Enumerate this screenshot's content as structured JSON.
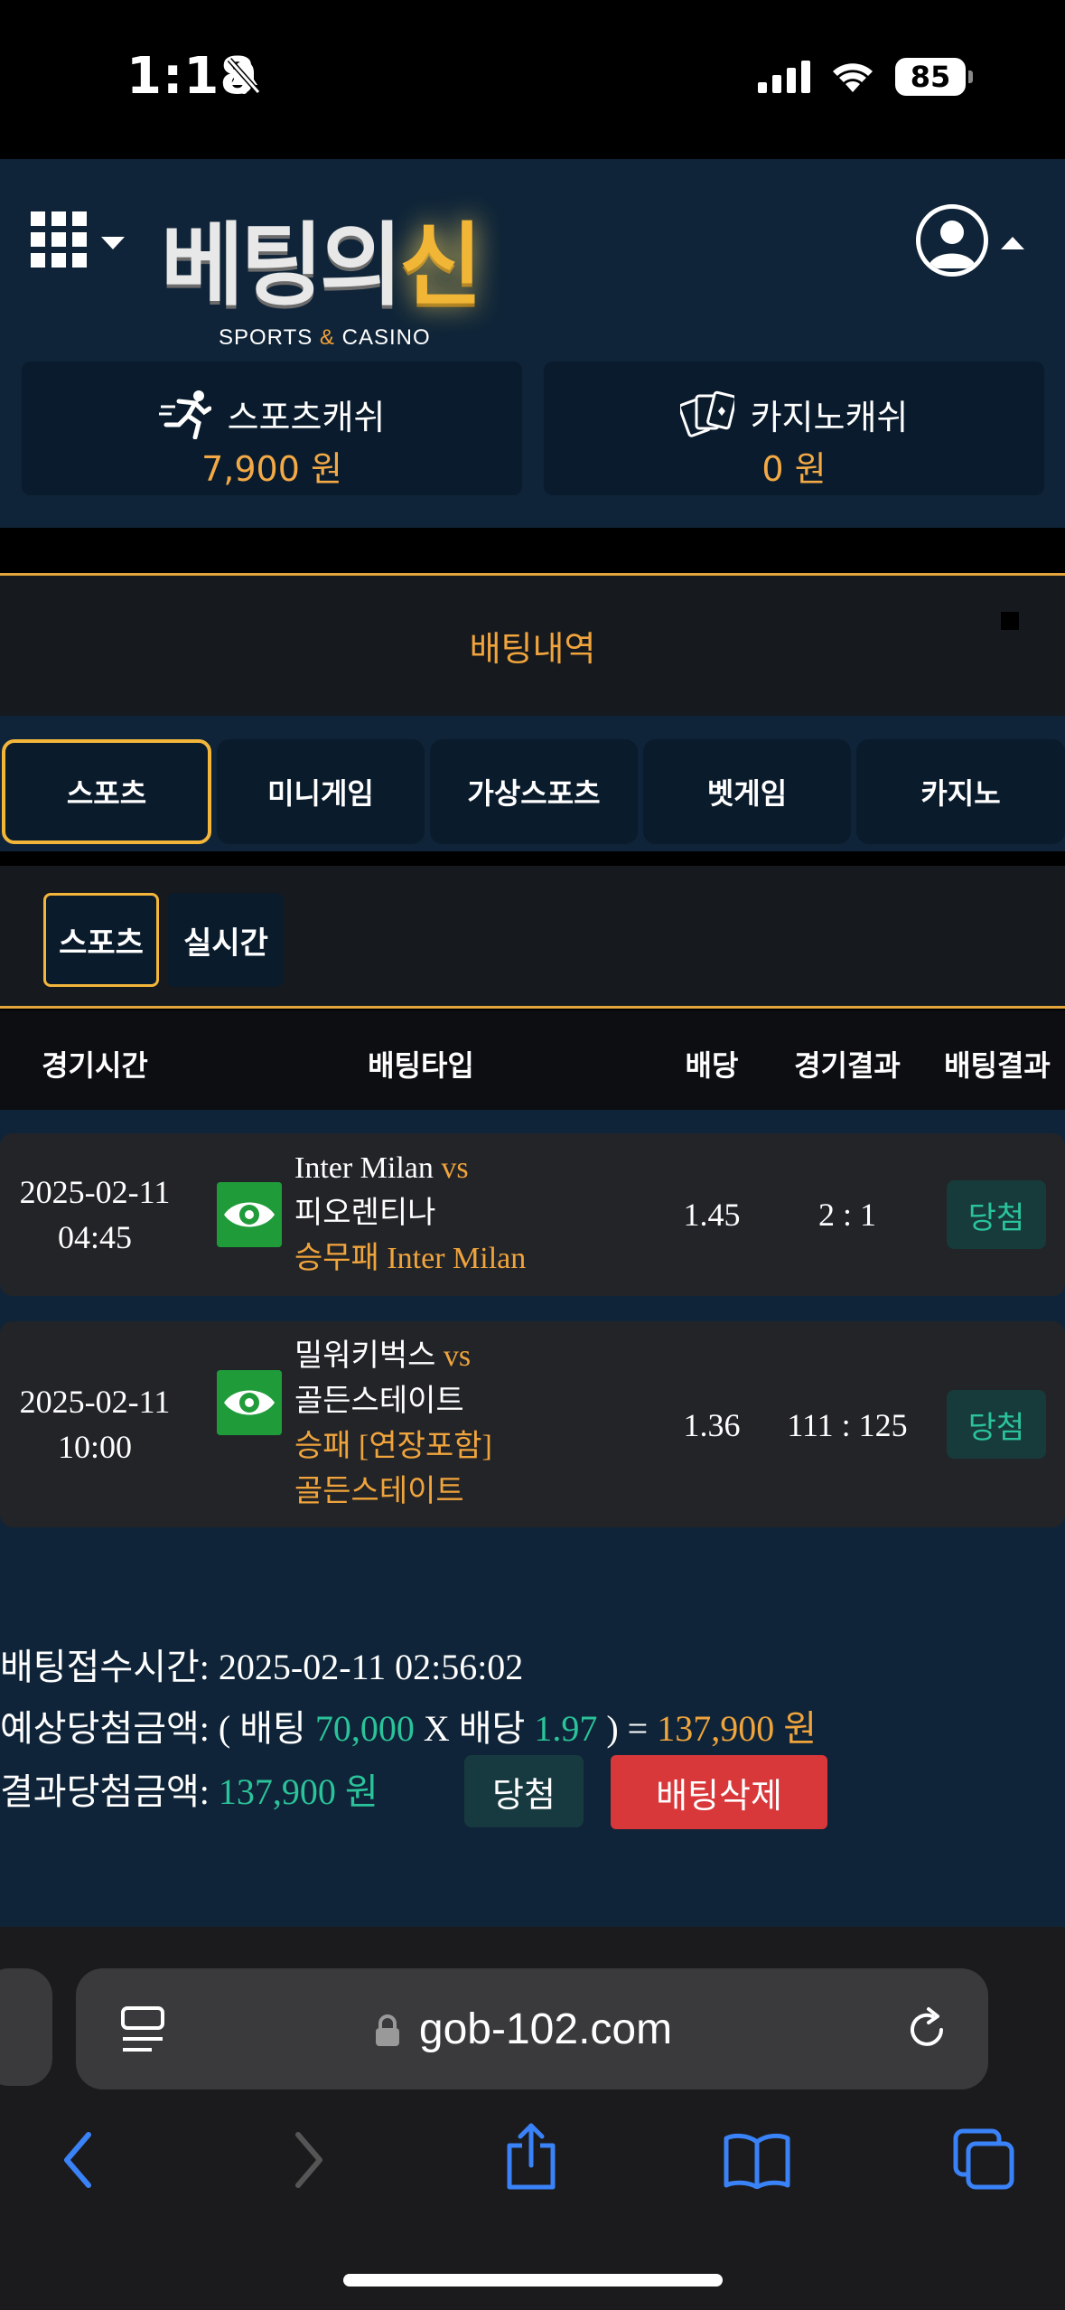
{
  "status_bar": {
    "time": "1:18",
    "battery": "85"
  },
  "header": {
    "logo_main": "베팅의",
    "logo_gold": "신",
    "logo_sub_left": "SPORTS",
    "logo_sub_amp": "&",
    "logo_sub_right": "CASINO",
    "sports_cash_label": "스포츠캐쉬",
    "sports_cash_value": "7,900 원",
    "casino_cash_label": "카지노캐쉬",
    "casino_cash_value": "0 원"
  },
  "page_title": "배팅내역",
  "tabs": [
    {
      "label": "스포츠",
      "active": true
    },
    {
      "label": "미니게임"
    },
    {
      "label": "가상스포츠"
    },
    {
      "label": "벳게임"
    },
    {
      "label": "카지노"
    }
  ],
  "subtabs": [
    {
      "label": "스포츠",
      "active": true
    },
    {
      "label": "실시간"
    }
  ],
  "table": {
    "headers": [
      "경기시간",
      "배팅타입",
      "배당",
      "경기결과",
      "배팅결과"
    ],
    "rows": [
      {
        "date": "2025-02-11",
        "time": "04:45",
        "home": "Inter Milan",
        "vs": "vs",
        "away": "피오렌티나",
        "pick_line1": "승무패 Inter Milan",
        "pick_line2": "",
        "odds": "1.45",
        "score": "2 : 1",
        "result": "당첨"
      },
      {
        "date": "2025-02-11",
        "time": "10:00",
        "home": "밀워키벅스",
        "vs": "vs",
        "away": "골든스테이트",
        "pick_line1": "승패 [연장포함]",
        "pick_line2": "골든스테이트",
        "odds": "1.36",
        "score": "111 : 125",
        "result": "당첨"
      }
    ]
  },
  "summary": {
    "time_label": "배팅접수시간: ",
    "time_value": "2025-02-11 02:56:02",
    "expected_label": "예상당첨금액: ( 배팅 ",
    "bet_amount": "70,000",
    "x_label": " X 배당 ",
    "total_odds": "1.97",
    "equals": " ) = ",
    "expected_amount": "137,900 원",
    "result_label": "결과당첨금액: ",
    "result_amount": "137,900 원",
    "win_button": "당첨",
    "delete_button": "배팅삭제"
  },
  "browser": {
    "url": "gob-102.com"
  },
  "colors": {
    "accent": "#f0a43c",
    "win_green": "#2bc39a",
    "header_bg": "#0f2438",
    "delete_red": "#d9383a"
  }
}
